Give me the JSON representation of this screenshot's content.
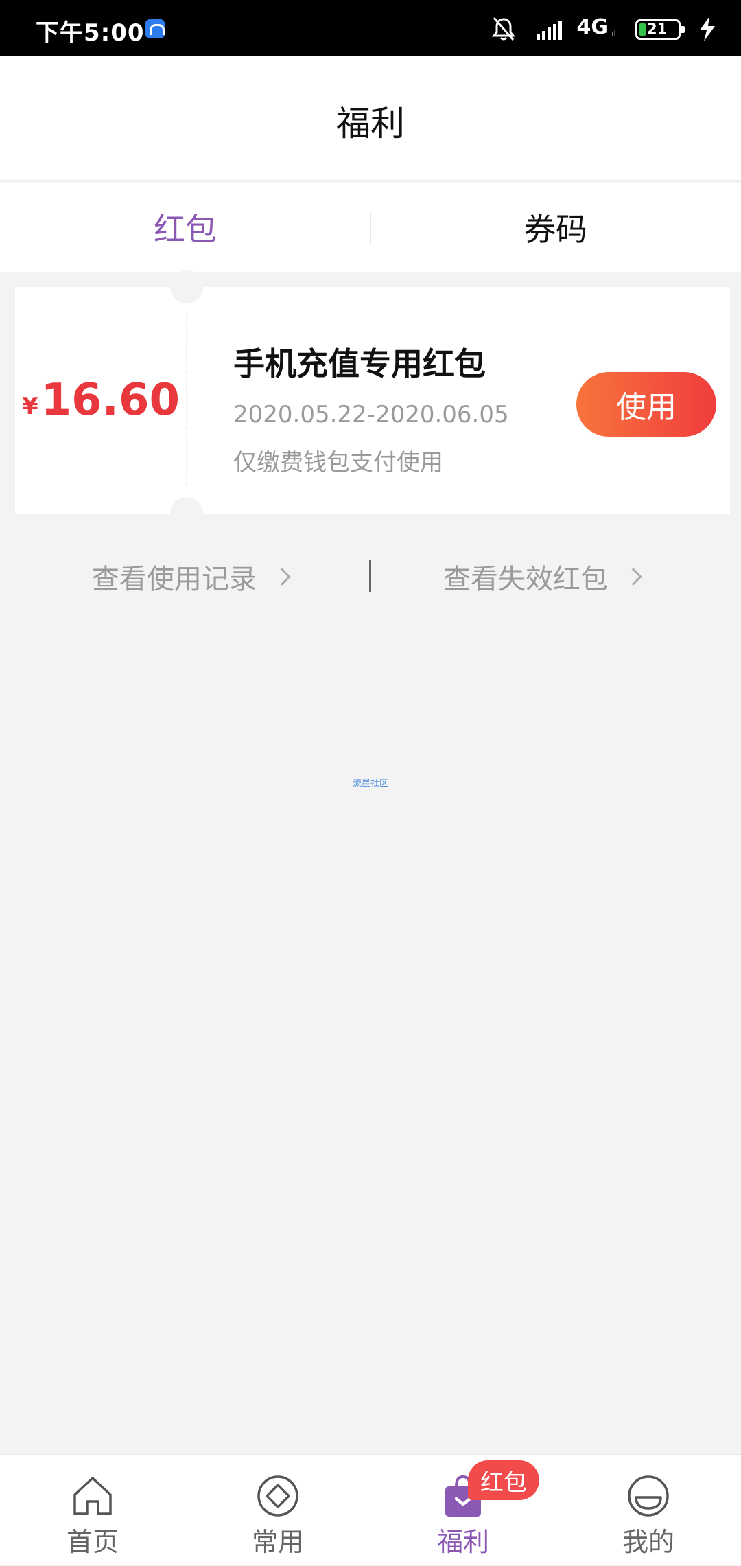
{
  "status_bar": {
    "time": "下午5:00",
    "network": "4G",
    "network_sub": "ıl",
    "battery": "21"
  },
  "header": {
    "title": "福利"
  },
  "tabs": [
    {
      "label": "红包",
      "active": true
    },
    {
      "label": "券码",
      "active": false
    }
  ],
  "coupon": {
    "currency": "¥",
    "amount": "16.60",
    "title": "手机充值专用红包",
    "dates": "2020.05.22-2020.06.05",
    "note": "仅缴费钱包支付使用",
    "use_label": "使用"
  },
  "links": {
    "history": "查看使用记录",
    "expired": "查看失效红包"
  },
  "watermark": "流星社区",
  "bottom_nav": {
    "items": [
      {
        "label": "首页",
        "icon": "home-icon"
      },
      {
        "label": "常用",
        "icon": "diamond-icon"
      },
      {
        "label": "福利",
        "icon": "gift-bag-icon",
        "active": true,
        "badge": "红包"
      },
      {
        "label": "我的",
        "icon": "smiley-icon"
      }
    ]
  },
  "colors": {
    "accent": "#8b58b4",
    "amount": "#e8383d",
    "button_start": "#f8743d",
    "button_end": "#f03d3d",
    "badge": "#f24b4b",
    "background": "#f3f3f3"
  }
}
